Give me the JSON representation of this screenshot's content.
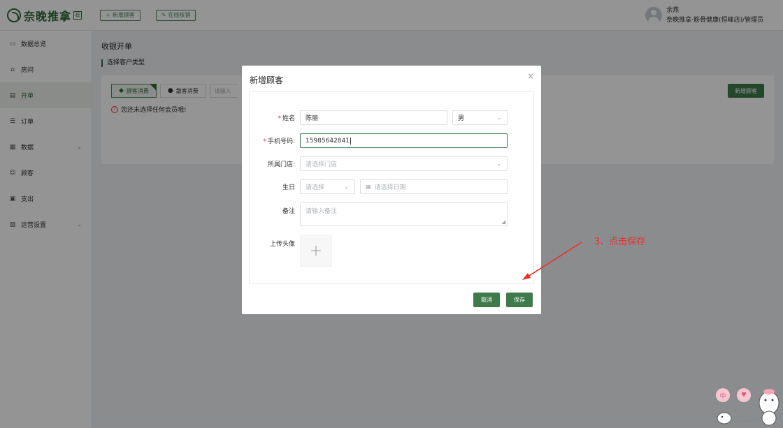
{
  "header": {
    "logo_text": "奈晚推拿",
    "logo_badge": "荐",
    "add_customer_btn": "新增顾客",
    "online_cancel_btn": "在线核销",
    "user_name": "余燕",
    "user_role": "奈晚推拿·筋骨健康(恒峰店)/管理员"
  },
  "sidebar": {
    "items": [
      {
        "label": "数据总览",
        "icon": "monitor-icon"
      },
      {
        "label": "房间",
        "icon": "home-icon"
      },
      {
        "label": "开单",
        "icon": "edit-icon"
      },
      {
        "label": "订单",
        "icon": "list-icon"
      },
      {
        "label": "数据",
        "icon": "chart-icon"
      },
      {
        "label": "顾客",
        "icon": "user-icon"
      },
      {
        "label": "支出",
        "icon": "wallet-icon"
      },
      {
        "label": "运营设置",
        "icon": "settings-icon"
      }
    ]
  },
  "main": {
    "page_title": "收银开单",
    "section_title": "选择客户类型",
    "tabs": [
      "顾客消费",
      "散客消费"
    ],
    "search_placeholder": "请输入",
    "warning": "您还未选择任何会员哦!",
    "add_customer_btn": "新增顾客"
  },
  "dialog": {
    "title": "新增顾客",
    "close": "×",
    "name_label": "姓名",
    "name_value": "陈丽",
    "gender_value": "男",
    "phone_label": "手机号码:",
    "phone_value": "15985642841",
    "store_label": "所属门店:",
    "store_placeholder": "请选择门店",
    "birthday_label": "生日",
    "birthday_type_placeholder": "请选择",
    "birthday_date_placeholder": "请选择日期",
    "note_label": "备注",
    "note_placeholder": "请输入备注",
    "avatar_label": "上传头像",
    "cancel_btn": "取消",
    "save_btn": "保存"
  },
  "annotation": {
    "text": "3、点击保存",
    "color": "#e8302a"
  },
  "widgets": [
    "中",
    "♥"
  ],
  "colors": {
    "brand": "#3f7a4a",
    "required": "#e03b3b",
    "warning": "#d9363e"
  }
}
